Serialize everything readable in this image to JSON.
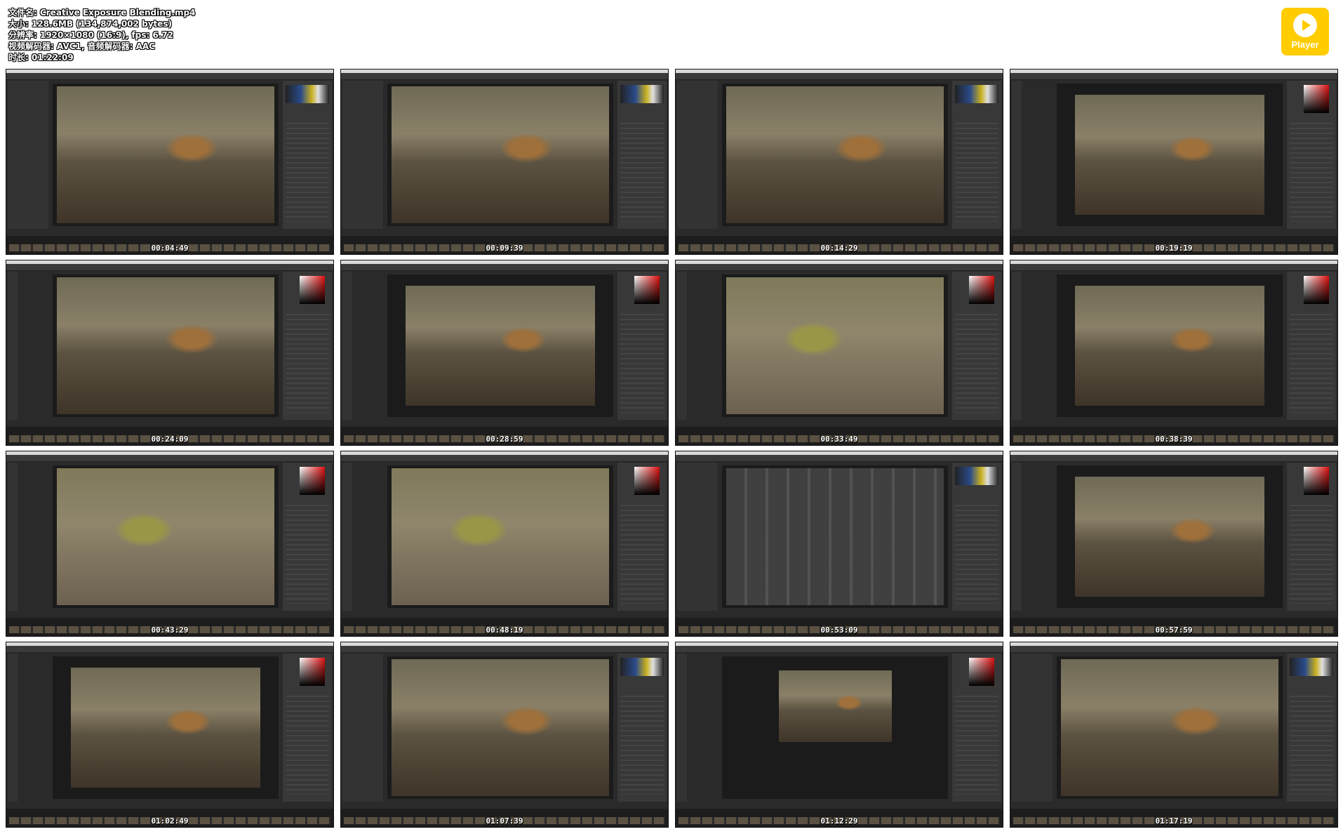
{
  "file_info": {
    "filename": "文件名: Creative Exposure Blending.mp4",
    "size": "大小: 128.6MB (134,874,002 bytes)",
    "resolution": "分辨率: 1920×1080 (16:9), fps: 6.72",
    "codec": "视频解码器: AVC1, 音频解码器: AAC",
    "duration": "时长: 01:22:09"
  },
  "player_badge": {
    "label": "Player",
    "icon": "play-icon",
    "color": "#ffcc00"
  },
  "thumbnails": [
    {
      "timestamp": "00:04:49",
      "app": "lightroom"
    },
    {
      "timestamp": "00:09:39",
      "app": "lightroom"
    },
    {
      "timestamp": "00:14:29",
      "app": "lightroom"
    },
    {
      "timestamp": "00:19:19",
      "app": "photoshop"
    },
    {
      "timestamp": "00:24:09",
      "app": "photoshop"
    },
    {
      "timestamp": "00:28:59",
      "app": "photoshop"
    },
    {
      "timestamp": "00:33:49",
      "app": "photoshop"
    },
    {
      "timestamp": "00:38:39",
      "app": "photoshop"
    },
    {
      "timestamp": "00:43:29",
      "app": "photoshop"
    },
    {
      "timestamp": "00:48:19",
      "app": "photoshop"
    },
    {
      "timestamp": "00:53:09",
      "app": "lightroom"
    },
    {
      "timestamp": "00:57:59",
      "app": "photoshop"
    },
    {
      "timestamp": "01:02:49",
      "app": "photoshop"
    },
    {
      "timestamp": "01:07:39",
      "app": "lightroom"
    },
    {
      "timestamp": "01:12:29",
      "app": "photoshop"
    },
    {
      "timestamp": "01:17:19",
      "app": "lightroom"
    }
  ]
}
